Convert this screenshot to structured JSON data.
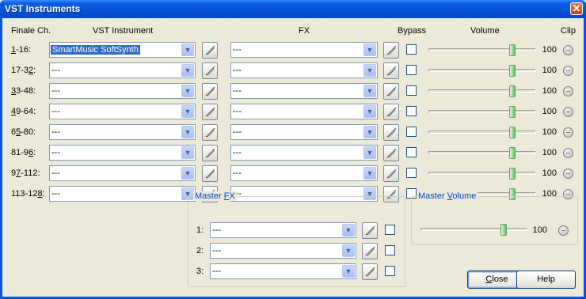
{
  "window": {
    "title": "VST Instruments",
    "close_glyph": "✕"
  },
  "headers": {
    "finale_ch": "Finale Ch.",
    "vst_instrument": "VST Instrument",
    "fx": "FX",
    "bypass": "Bypass",
    "volume": "Volume",
    "clip": "Clip"
  },
  "rows": [
    {
      "pre": "",
      "ul": "1",
      "post": "-16:",
      "instrument": "SmartMusic SoftSynth",
      "fx": "---",
      "bypass": false,
      "volume": "100"
    },
    {
      "pre": "17-3",
      "ul": "2",
      "post": ":",
      "instrument": "---",
      "fx": "---",
      "bypass": false,
      "volume": "100"
    },
    {
      "pre": "",
      "ul": "3",
      "post": "3-48:",
      "instrument": "---",
      "fx": "---",
      "bypass": false,
      "volume": "100"
    },
    {
      "pre": "",
      "ul": "4",
      "post": "9-64:",
      "instrument": "---",
      "fx": "---",
      "bypass": false,
      "volume": "100"
    },
    {
      "pre": "6",
      "ul": "5",
      "post": "-80:",
      "instrument": "---",
      "fx": "---",
      "bypass": false,
      "volume": "100"
    },
    {
      "pre": "81-9",
      "ul": "6",
      "post": ":",
      "instrument": "---",
      "fx": "---",
      "bypass": false,
      "volume": "100"
    },
    {
      "pre": "9",
      "ul": "7",
      "post": "-112:",
      "instrument": "---",
      "fx": "---",
      "bypass": false,
      "volume": "100"
    },
    {
      "pre": "113-12",
      "ul": "8",
      "post": ":",
      "instrument": "---",
      "fx": "---",
      "bypass": false,
      "volume": "100"
    }
  ],
  "master_fx": {
    "label_pre": "Master ",
    "label_ul": "F",
    "label_post": "X",
    "slots": [
      {
        "label": "1:",
        "value": "---",
        "checked": false
      },
      {
        "label": "2:",
        "value": "---",
        "checked": false
      },
      {
        "label": "3:",
        "value": "---",
        "checked": false
      }
    ]
  },
  "master_volume": {
    "label_pre": "Master ",
    "label_ul": "V",
    "label_post": "olume",
    "value": "100"
  },
  "buttons": {
    "close": {
      "ul": "C",
      "rest": "lose"
    },
    "help": "Help"
  },
  "icons": {
    "dropdown": "chevron-down-icon",
    "edit": "edit-pencil-icon",
    "clip": "clip-indicator-icon"
  },
  "colors": {
    "title_bar": "#0a5fe6",
    "group_label": "#0046d5",
    "selection": "#316ac5",
    "thumb": "#5dc25d"
  }
}
